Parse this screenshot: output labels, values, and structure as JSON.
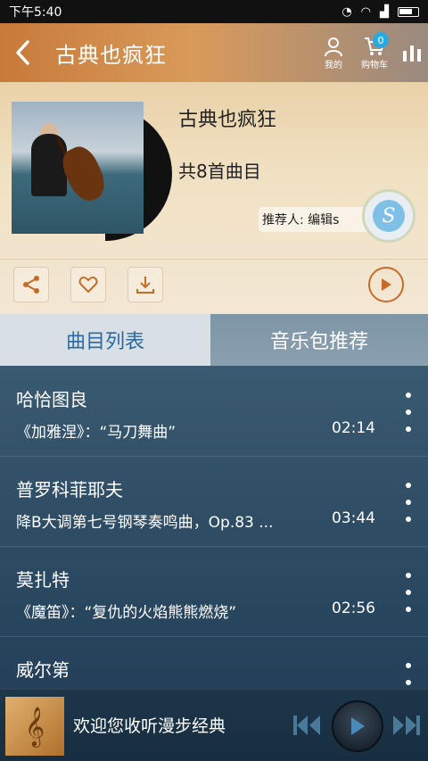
{
  "status_bar": {
    "time": "下午5:40"
  },
  "header": {
    "title": "古典也疯狂",
    "profile_label": "我的",
    "cart_label": "购物车",
    "cart_count": "0"
  },
  "album": {
    "title": "古典也疯狂",
    "track_count": "共8首曲目",
    "recommender": "推荐人: 编辑s",
    "avatar_letter": "S"
  },
  "tabs": [
    {
      "label": "曲目列表",
      "active": true
    },
    {
      "label": "音乐包推荐",
      "active": false
    }
  ],
  "tracks": [
    {
      "name": "哈恰图良",
      "desc": "《加雅涅》：“马刀舞曲”",
      "duration": "02:14"
    },
    {
      "name": "普罗科菲耶夫",
      "desc": "降B大调第七号钢琴奏鸣曲，Op.83 ...",
      "duration": "03:44"
    },
    {
      "name": "莫扎特",
      "desc": "《魔笛》：“复仇的火焰熊熊燃烧”",
      "duration": "02:56"
    },
    {
      "name": "威尔第",
      "desc": "",
      "duration": ""
    }
  ],
  "player": {
    "text": "欢迎您收听漫步经典"
  },
  "colors": {
    "accent": "#c56c2a",
    "tab_active_text": "#2a6aa0",
    "badge": "#2aa9e0"
  }
}
